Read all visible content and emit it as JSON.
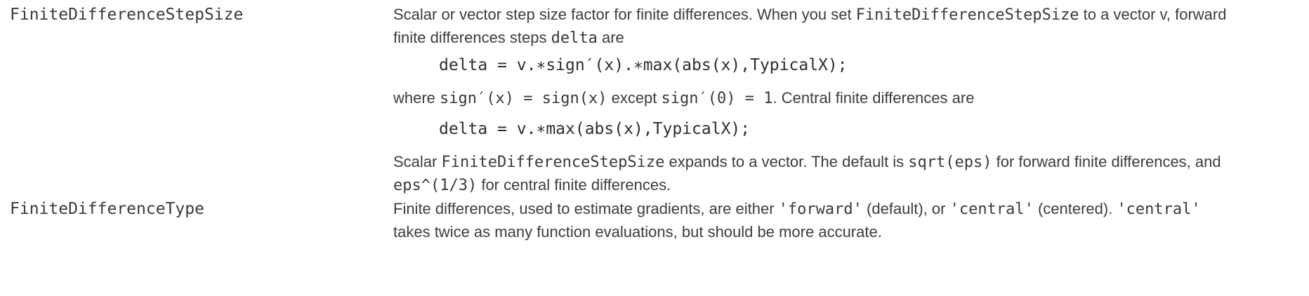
{
  "rows": [
    {
      "name": "FiniteDifferenceStepSize",
      "p1": {
        "t1": "Scalar or vector step size factor for finite differences. When you set ",
        "c1": "FiniteDifferenceStepSize",
        "t2": " to a vector ",
        "v": "v",
        "t3": ", forward",
        "t4": "finite differences steps ",
        "c2": "delta",
        "t5": " are"
      },
      "code1": "delta = v.∗sign′(x).∗max(abs(x),TypicalX);",
      "p2": {
        "t1": "where ",
        "c1": "sign′(x) = sign(x)",
        "t2": " except ",
        "c2": "sign′(0) = 1",
        "t3": ". Central finite differences are"
      },
      "code2": "delta = v.∗max(abs(x),TypicalX);",
      "p3": {
        "t1": "Scalar ",
        "c1": "FiniteDifferenceStepSize",
        "t2": " expands to a vector. The default is ",
        "c2": "sqrt(eps)",
        "t3": " for forward finite differences, and",
        "c3": "eps^(1/3)",
        "t4": " for central finite differences."
      }
    },
    {
      "name": "FiniteDifferenceType",
      "p1": {
        "t1": "Finite differences, used to estimate gradients, are either ",
        "c1": "'forward'",
        "t2": " (default), or ",
        "c2": "'central'",
        "t3": " (centered). ",
        "c3": "'central'",
        "t4": "takes twice as many function evaluations, but should be more accurate."
      }
    }
  ]
}
